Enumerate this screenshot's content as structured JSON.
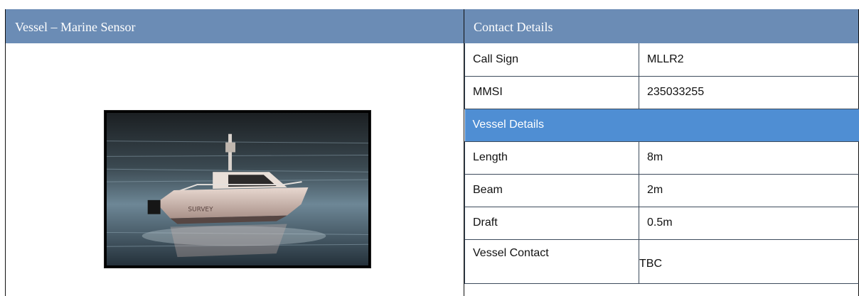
{
  "vessel": {
    "header": "Vessel – Marine Sensor",
    "photo_label": "SURVEY"
  },
  "contact": {
    "header": "Contact Details",
    "rows": [
      {
        "label": "Call Sign",
        "value": "MLLR2"
      },
      {
        "label": "MMSI",
        "value": "235033255"
      }
    ]
  },
  "vessel_details": {
    "header": "Vessel Details",
    "rows": [
      {
        "label": "Length",
        "value": "8m"
      },
      {
        "label": "Beam",
        "value": "2m"
      },
      {
        "label": "Draft",
        "value": "0.5m"
      },
      {
        "label": "Vessel Contact",
        "value": "TBC"
      }
    ]
  },
  "colors": {
    "header_bg": "#6b8cb5",
    "section_bg": "#4f8ed3",
    "border": "#3d4b5c"
  }
}
